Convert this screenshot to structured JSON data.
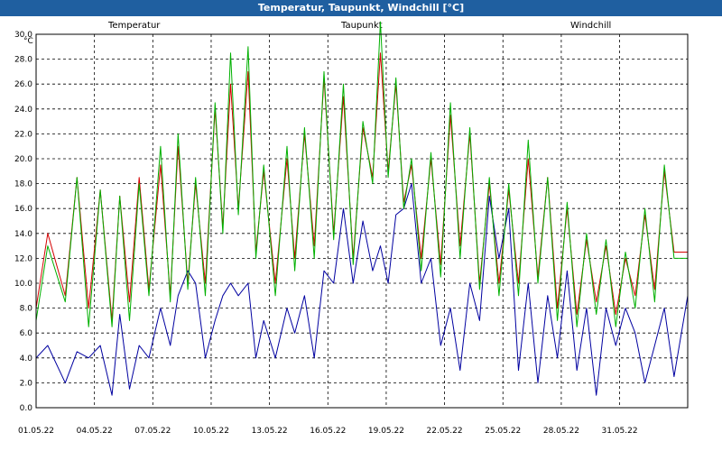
{
  "window": {
    "title": "Temperatur, Taupunkt, Windchill [°C]"
  },
  "colors": {
    "titlebar": "#1f5fa0",
    "temperature": "#d40000",
    "dewpoint": "#0000a0",
    "windchill": "#00b000",
    "grid": "#000000"
  },
  "chart_data": {
    "type": "line",
    "title": "Temperatur, Taupunkt, Windchill [°C]",
    "ylabel": "°C",
    "xlabel": "",
    "ylim": [
      0,
      30
    ],
    "y_ticks": [
      "0.0",
      "2.0",
      "4.0",
      "6.0",
      "8.0",
      "10.0",
      "12.0",
      "14.0",
      "16.0",
      "18.0",
      "20.0",
      "22.0",
      "24.0",
      "26.0",
      "28.0",
      "30.0"
    ],
    "x_ticks": [
      "01.05.22",
      "04.05.22",
      "07.05.22",
      "10.05.22",
      "13.05.22",
      "16.05.22",
      "19.05.22",
      "22.05.22",
      "25.05.22",
      "28.05.22",
      "31.05.22"
    ],
    "x_range_days": [
      0,
      33.5
    ],
    "grid": "dashed",
    "legend_position": "top",
    "x_days": [
      0,
      0.6,
      1.5,
      2.1,
      2.7,
      3.3,
      3.9,
      4.3,
      4.8,
      5.3,
      5.8,
      6.4,
      6.9,
      7.3,
      7.8,
      8.2,
      8.7,
      9.2,
      9.6,
      10.0,
      10.4,
      10.9,
      11.3,
      11.7,
      12.3,
      12.9,
      13.3,
      13.8,
      14.3,
      14.8,
      15.3,
      15.8,
      16.3,
      16.8,
      17.3,
      17.7,
      18.1,
      18.5,
      18.9,
      19.3,
      19.8,
      20.3,
      20.8,
      21.3,
      21.8,
      22.3,
      22.8,
      23.3,
      23.8,
      24.3,
      24.8,
      25.3,
      25.8,
      26.3,
      26.8,
      27.3,
      27.8,
      28.3,
      28.8,
      29.3,
      29.8,
      30.3,
      30.8,
      31.3,
      31.8,
      32.3,
      32.8,
      33.5
    ],
    "series": [
      {
        "name": "Temperatur",
        "color": "#d40000",
        "values": [
          8.0,
          14.0,
          9.0,
          18.5,
          8.0,
          17.5,
          7.0,
          17.0,
          8.5,
          18.5,
          9.5,
          19.5,
          9.0,
          21.0,
          10.0,
          18.0,
          10.0,
          24.0,
          14.5,
          26.0,
          16.0,
          27.0,
          12.5,
          19.0,
          10.0,
          20.0,
          12.0,
          22.0,
          13.0,
          26.5,
          14.0,
          25.0,
          12.0,
          22.5,
          18.5,
          28.5,
          19.0,
          26.0,
          16.5,
          19.5,
          12.0,
          20.0,
          11.5,
          23.5,
          13.0,
          22.0,
          10.0,
          18.0,
          10.0,
          17.5,
          10.0,
          20.0,
          10.5,
          18.5,
          8.0,
          16.0,
          7.5,
          13.5,
          8.5,
          13.0,
          7.5,
          12.0,
          9.0,
          15.5,
          9.5,
          19.0,
          12.5,
          12.5
        ]
      },
      {
        "name": "Taupunkt",
        "color": "#0000a0",
        "values": [
          4.0,
          5.0,
          2.0,
          4.5,
          4.0,
          5.0,
          1.0,
          7.5,
          1.5,
          5.0,
          4.0,
          8.0,
          5.0,
          9.0,
          11.0,
          10.0,
          4.0,
          7.0,
          9.0,
          10.0,
          9.0,
          10.0,
          4.0,
          7.0,
          4.0,
          8.0,
          6.0,
          9.0,
          4.0,
          11.0,
          10.0,
          16.0,
          10.0,
          15.0,
          11.0,
          13.0,
          10.0,
          15.5,
          16.0,
          18.0,
          10.0,
          12.0,
          5.0,
          8.0,
          3.0,
          10.0,
          7.0,
          17.0,
          12.0,
          16.0,
          3.0,
          10.0,
          2.0,
          9.0,
          4.0,
          11.0,
          3.0,
          8.0,
          1.0,
          8.0,
          5.0,
          8.0,
          6.0,
          2.0,
          5.0,
          8.0,
          2.5,
          9.0
        ]
      },
      {
        "name": "Windchill",
        "color": "#00b000",
        "values": [
          7.0,
          13.0,
          8.5,
          18.5,
          6.5,
          17.5,
          6.5,
          17.0,
          7.0,
          18.0,
          9.0,
          21.0,
          8.5,
          22.0,
          9.5,
          18.5,
          9.0,
          24.5,
          14.0,
          28.5,
          15.5,
          29.0,
          12.0,
          19.5,
          9.0,
          21.0,
          11.0,
          22.5,
          12.0,
          27.0,
          13.5,
          26.0,
          11.5,
          23.0,
          18.0,
          31.0,
          18.5,
          26.5,
          16.0,
          20.0,
          11.0,
          20.5,
          10.5,
          24.5,
          12.0,
          22.5,
          9.5,
          18.5,
          9.0,
          18.0,
          9.0,
          21.5,
          10.0,
          18.5,
          7.0,
          16.5,
          6.5,
          14.0,
          7.5,
          13.5,
          6.5,
          12.5,
          8.0,
          16.0,
          8.5,
          19.5,
          12.0,
          12.0
        ]
      }
    ]
  }
}
